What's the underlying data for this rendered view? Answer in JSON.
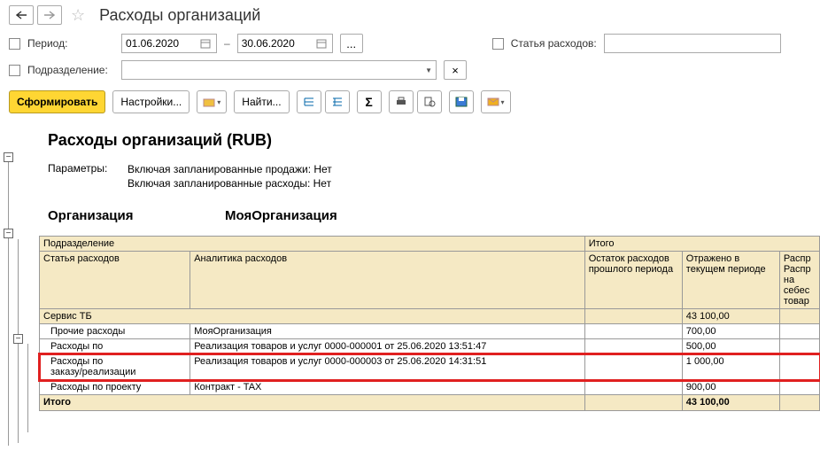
{
  "nav": {
    "title": "Расходы организаций"
  },
  "filters": {
    "period_label": "Период:",
    "date_from": "01.06.2020",
    "date_to": "30.06.2020",
    "expense_item_label": "Статья расходов:",
    "department_label": "Подразделение:"
  },
  "toolbar": {
    "generate": "Сформировать",
    "settings": "Настройки...",
    "find": "Найти..."
  },
  "report": {
    "title": "Расходы организаций (RUB)",
    "params_label": "Параметры:",
    "params_1": "Включая запланированные продажи: Нет",
    "params_2": "Включая запланированные расходы: Нет",
    "org_label": "Организация",
    "org_value": "МояОрганизация"
  },
  "table": {
    "head": {
      "department": "Подразделение",
      "total": "Итого",
      "expense_item": "Статья расходов",
      "analytics": "Аналитика расходов",
      "prev_balance": "Остаток расходов прошлого периода",
      "reflected": "Отражено в текущем периоде",
      "distrib": "Распр\nРаспр\nна\nсебес\nтовар"
    },
    "group": {
      "name": "Сервис ТБ",
      "reflected": "43 100,00"
    },
    "rows": [
      {
        "item": "Прочие расходы",
        "analytics": "МояОрганизация",
        "reflected": "700,00"
      },
      {
        "item": "Расходы по",
        "item2": "",
        "analytics": "Реализация товаров и услуг 0000-000001 от 25.06.2020 13:51:47",
        "reflected": "500,00"
      },
      {
        "item": "Расходы по",
        "item2": "заказу/реализации",
        "analytics": "Реализация товаров и услуг 0000-000003 от 25.06.2020 14:31:51",
        "reflected": "1 000,00",
        "highlight": true
      },
      {
        "item": "Расходы по проекту",
        "analytics": "Контракт - TAX",
        "reflected": "900,00"
      }
    ],
    "total": {
      "label": "Итого",
      "reflected": "43 100,00"
    }
  }
}
